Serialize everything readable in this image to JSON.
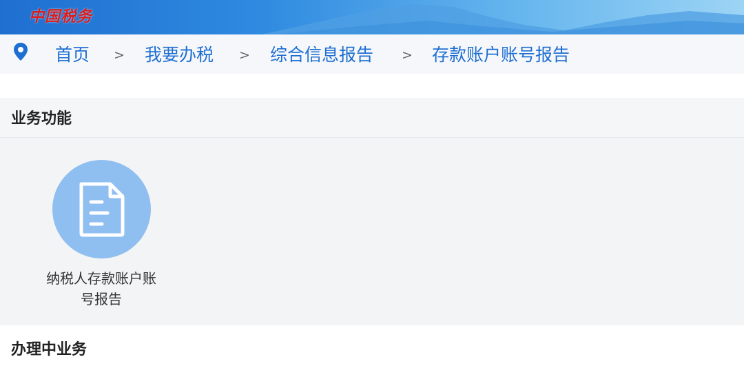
{
  "header": {
    "logo_text": "中国税务",
    "colors": {
      "logo": "#d81e1e",
      "banner": "#2f8ae0"
    }
  },
  "breadcrumb": {
    "icon": "location-pin-icon",
    "items": [
      {
        "label": "首页"
      },
      {
        "label": "我要办税"
      },
      {
        "label": "综合信息报告"
      },
      {
        "label": "存款账户账号报告"
      }
    ],
    "separator": ">"
  },
  "sections": {
    "business_functions": {
      "title": "业务功能",
      "items": [
        {
          "label_line1": "纳税人存款账户账",
          "label_line2": "号报告",
          "icon": "document-icon"
        }
      ]
    },
    "in_progress": {
      "title": "办理中业务"
    }
  },
  "colors": {
    "accent": "#1e6fd2",
    "tile": "#8fbef0"
  }
}
